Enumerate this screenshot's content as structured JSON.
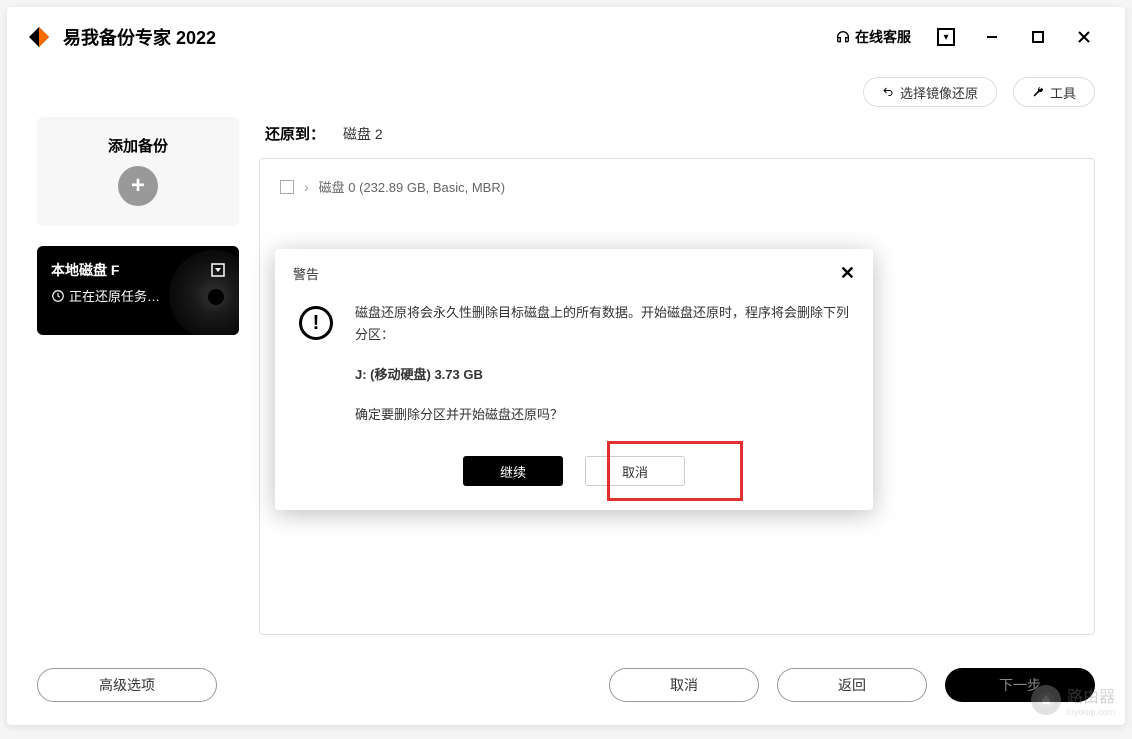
{
  "titlebar": {
    "app_name": "易我备份专家 2022",
    "online_service": "在线客服"
  },
  "toolbar": {
    "select_image_restore": "选择镜像还原",
    "tools": "工具"
  },
  "sidebar": {
    "add_backup": "添加备份",
    "task": {
      "title": "本地磁盘 F",
      "status": "正在还原任务…"
    }
  },
  "content": {
    "restore_to_label": "还原到：",
    "restore_target": "磁盘 2",
    "disk0_label": "磁盘 0 (232.89 GB, Basic, MBR)"
  },
  "modal": {
    "title": "警告",
    "body_line1": "磁盘还原将会永久性删除目标磁盘上的所有数据。开始磁盘还原时，程序将会删除下列分区：",
    "partition": "J: (移动硬盘) 3.73 GB",
    "body_line2": "确定要删除分区并开始磁盘还原吗？",
    "continue": "继续",
    "cancel": "取消"
  },
  "footer": {
    "advanced": "高级选项",
    "cancel": "取消",
    "back": "返回",
    "next": "下一步"
  },
  "watermark": {
    "text": "路由器",
    "sub": "luyouqi.com"
  }
}
